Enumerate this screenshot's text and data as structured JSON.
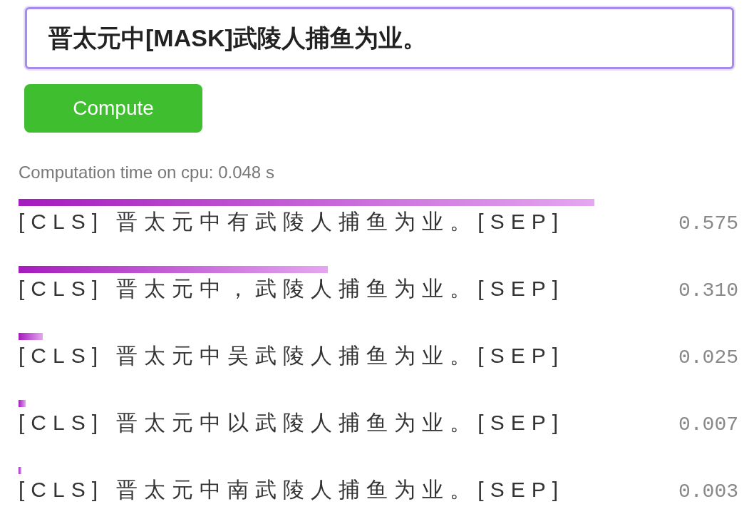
{
  "input": {
    "value": "晋太元中[MASK]武陵人捕鱼为业。"
  },
  "compute_button": {
    "label": "Compute"
  },
  "computation_time": "Computation time on cpu: 0.048 s",
  "results": [
    {
      "text": "[CLS] 晋太元中有武陵人捕鱼为业。[SEP]",
      "score": "0.575",
      "level": 0.8
    },
    {
      "text": "[CLS] 晋太元中，武陵人捕鱼为业。[SEP]",
      "score": "0.310",
      "level": 0.43
    },
    {
      "text": "[CLS] 晋太元中吴武陵人捕鱼为业。[SEP]",
      "score": "0.025",
      "level": 0.034
    },
    {
      "text": "[CLS] 晋太元中以武陵人捕鱼为业。[SEP]",
      "score": "0.007",
      "level": 0.01
    },
    {
      "text": "[CLS] 晋太元中南武陵人捕鱼为业。[SEP]",
      "score": "0.003",
      "level": 0.004
    }
  ]
}
